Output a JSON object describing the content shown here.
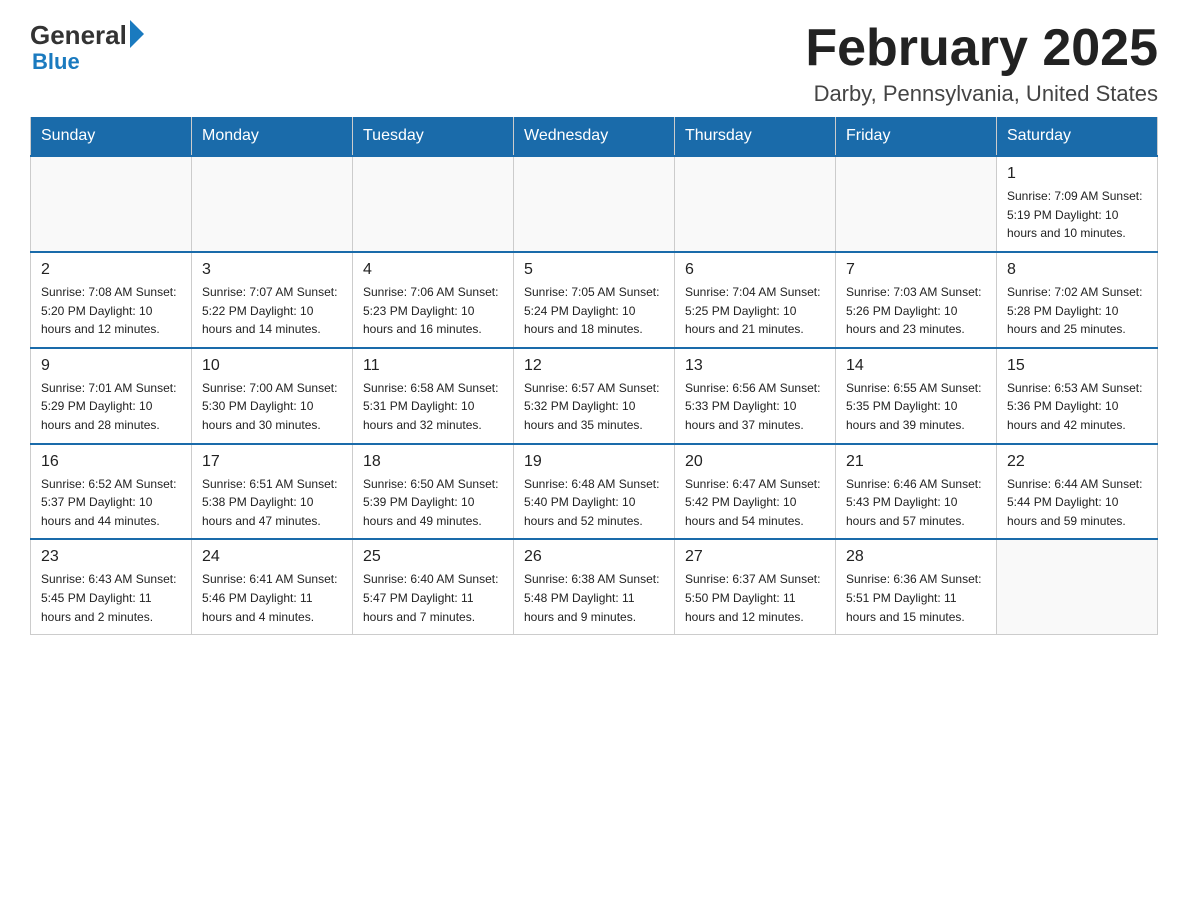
{
  "logo": {
    "general": "General",
    "blue": "Blue"
  },
  "header": {
    "title": "February 2025",
    "location": "Darby, Pennsylvania, United States"
  },
  "weekdays": [
    "Sunday",
    "Monday",
    "Tuesday",
    "Wednesday",
    "Thursday",
    "Friday",
    "Saturday"
  ],
  "weeks": [
    [
      {
        "day": "",
        "info": ""
      },
      {
        "day": "",
        "info": ""
      },
      {
        "day": "",
        "info": ""
      },
      {
        "day": "",
        "info": ""
      },
      {
        "day": "",
        "info": ""
      },
      {
        "day": "",
        "info": ""
      },
      {
        "day": "1",
        "info": "Sunrise: 7:09 AM\nSunset: 5:19 PM\nDaylight: 10 hours and 10 minutes."
      }
    ],
    [
      {
        "day": "2",
        "info": "Sunrise: 7:08 AM\nSunset: 5:20 PM\nDaylight: 10 hours and 12 minutes."
      },
      {
        "day": "3",
        "info": "Sunrise: 7:07 AM\nSunset: 5:22 PM\nDaylight: 10 hours and 14 minutes."
      },
      {
        "day": "4",
        "info": "Sunrise: 7:06 AM\nSunset: 5:23 PM\nDaylight: 10 hours and 16 minutes."
      },
      {
        "day": "5",
        "info": "Sunrise: 7:05 AM\nSunset: 5:24 PM\nDaylight: 10 hours and 18 minutes."
      },
      {
        "day": "6",
        "info": "Sunrise: 7:04 AM\nSunset: 5:25 PM\nDaylight: 10 hours and 21 minutes."
      },
      {
        "day": "7",
        "info": "Sunrise: 7:03 AM\nSunset: 5:26 PM\nDaylight: 10 hours and 23 minutes."
      },
      {
        "day": "8",
        "info": "Sunrise: 7:02 AM\nSunset: 5:28 PM\nDaylight: 10 hours and 25 minutes."
      }
    ],
    [
      {
        "day": "9",
        "info": "Sunrise: 7:01 AM\nSunset: 5:29 PM\nDaylight: 10 hours and 28 minutes."
      },
      {
        "day": "10",
        "info": "Sunrise: 7:00 AM\nSunset: 5:30 PM\nDaylight: 10 hours and 30 minutes."
      },
      {
        "day": "11",
        "info": "Sunrise: 6:58 AM\nSunset: 5:31 PM\nDaylight: 10 hours and 32 minutes."
      },
      {
        "day": "12",
        "info": "Sunrise: 6:57 AM\nSunset: 5:32 PM\nDaylight: 10 hours and 35 minutes."
      },
      {
        "day": "13",
        "info": "Sunrise: 6:56 AM\nSunset: 5:33 PM\nDaylight: 10 hours and 37 minutes."
      },
      {
        "day": "14",
        "info": "Sunrise: 6:55 AM\nSunset: 5:35 PM\nDaylight: 10 hours and 39 minutes."
      },
      {
        "day": "15",
        "info": "Sunrise: 6:53 AM\nSunset: 5:36 PM\nDaylight: 10 hours and 42 minutes."
      }
    ],
    [
      {
        "day": "16",
        "info": "Sunrise: 6:52 AM\nSunset: 5:37 PM\nDaylight: 10 hours and 44 minutes."
      },
      {
        "day": "17",
        "info": "Sunrise: 6:51 AM\nSunset: 5:38 PM\nDaylight: 10 hours and 47 minutes."
      },
      {
        "day": "18",
        "info": "Sunrise: 6:50 AM\nSunset: 5:39 PM\nDaylight: 10 hours and 49 minutes."
      },
      {
        "day": "19",
        "info": "Sunrise: 6:48 AM\nSunset: 5:40 PM\nDaylight: 10 hours and 52 minutes."
      },
      {
        "day": "20",
        "info": "Sunrise: 6:47 AM\nSunset: 5:42 PM\nDaylight: 10 hours and 54 minutes."
      },
      {
        "day": "21",
        "info": "Sunrise: 6:46 AM\nSunset: 5:43 PM\nDaylight: 10 hours and 57 minutes."
      },
      {
        "day": "22",
        "info": "Sunrise: 6:44 AM\nSunset: 5:44 PM\nDaylight: 10 hours and 59 minutes."
      }
    ],
    [
      {
        "day": "23",
        "info": "Sunrise: 6:43 AM\nSunset: 5:45 PM\nDaylight: 11 hours and 2 minutes."
      },
      {
        "day": "24",
        "info": "Sunrise: 6:41 AM\nSunset: 5:46 PM\nDaylight: 11 hours and 4 minutes."
      },
      {
        "day": "25",
        "info": "Sunrise: 6:40 AM\nSunset: 5:47 PM\nDaylight: 11 hours and 7 minutes."
      },
      {
        "day": "26",
        "info": "Sunrise: 6:38 AM\nSunset: 5:48 PM\nDaylight: 11 hours and 9 minutes."
      },
      {
        "day": "27",
        "info": "Sunrise: 6:37 AM\nSunset: 5:50 PM\nDaylight: 11 hours and 12 minutes."
      },
      {
        "day": "28",
        "info": "Sunrise: 6:36 AM\nSunset: 5:51 PM\nDaylight: 11 hours and 15 minutes."
      },
      {
        "day": "",
        "info": ""
      }
    ]
  ]
}
